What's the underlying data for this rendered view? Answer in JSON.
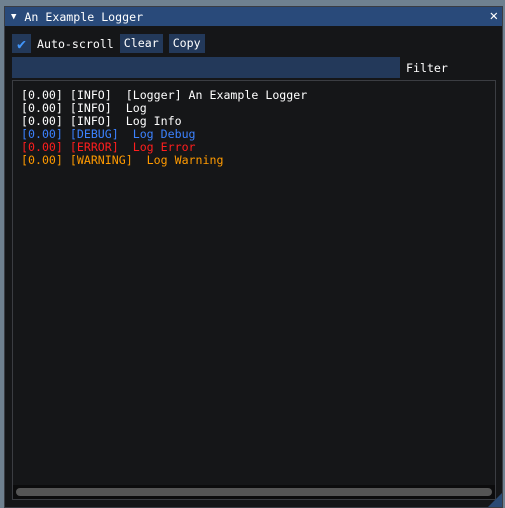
{
  "window": {
    "title": "An Example Logger",
    "close_icon": "close-icon",
    "collapse_icon": "triangle-down-icon"
  },
  "toolbar": {
    "autoscroll_label": "Auto-scroll",
    "autoscroll_checked": true,
    "clear_label": "Clear",
    "copy_label": "Copy"
  },
  "filter": {
    "label": "Filter",
    "value": ""
  },
  "colors": {
    "info": "#ffffff",
    "debug": "#3c82ff",
    "error": "#ff1e1e",
    "warning": "#ff9a00",
    "title_bar": "#294a7a",
    "frame": "#23395a"
  },
  "log": [
    {
      "time": "[0.00]",
      "level": "[INFO]",
      "msg": "[Logger] An Example Logger",
      "color": "#ffffff"
    },
    {
      "time": "[0.00]",
      "level": "[INFO]",
      "msg": "Log",
      "color": "#ffffff"
    },
    {
      "time": "[0.00]",
      "level": "[INFO]",
      "msg": "Log Info",
      "color": "#ffffff"
    },
    {
      "time": "[0.00]",
      "level": "[DEBUG]",
      "msg": "Log Debug",
      "color": "#3c82ff"
    },
    {
      "time": "[0.00]",
      "level": "[ERROR]",
      "msg": "Log Error",
      "color": "#ff1e1e"
    },
    {
      "time": "[0.00]",
      "level": "[WARNING]",
      "msg": "Log Warning",
      "color": "#ff9a00"
    }
  ]
}
